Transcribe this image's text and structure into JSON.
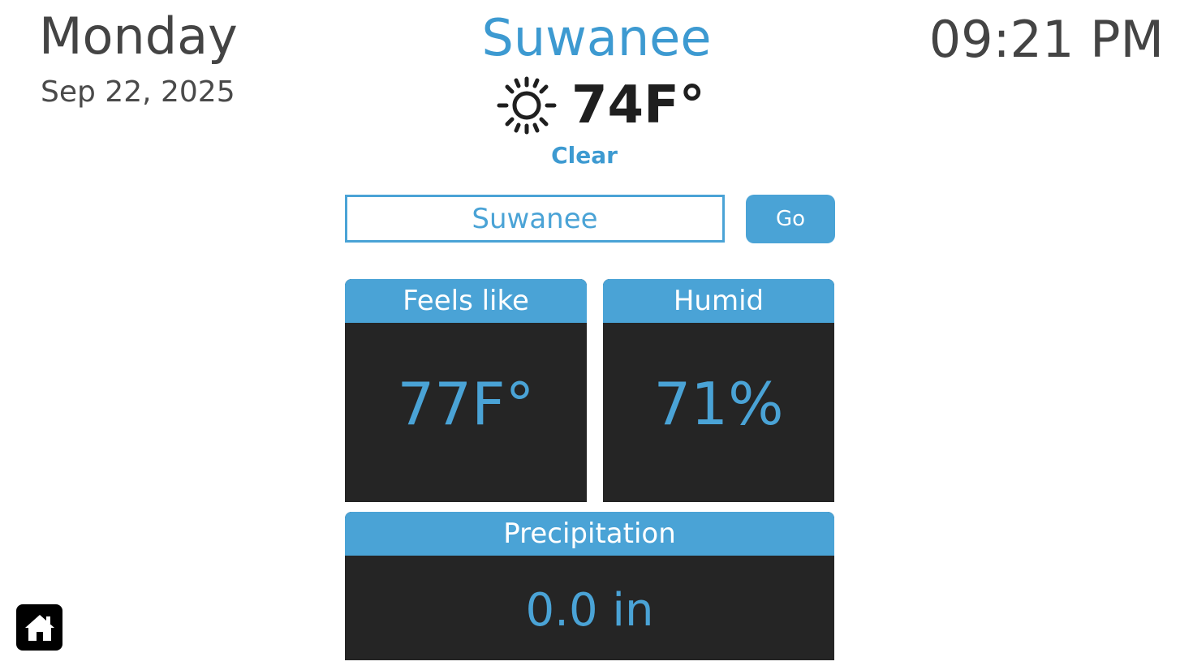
{
  "header": {
    "day": "Monday",
    "date": "Sep 22, 2025",
    "time": "09:21 PM",
    "city": "Suwanee"
  },
  "current": {
    "temperature": "74F°",
    "condition": "Clear",
    "icon": "sun-icon"
  },
  "search": {
    "value": "Suwanee",
    "button_label": "Go"
  },
  "cards": {
    "feels_like": {
      "label": "Feels like",
      "value": "77F°"
    },
    "humidity": {
      "label": "Humid",
      "value": "71%"
    },
    "precipitation": {
      "label": "Precipitation",
      "value": "0.0 in"
    }
  },
  "home": {
    "icon": "home-icon"
  },
  "colors": {
    "accent": "#4aa3d6",
    "card_background": "#252525",
    "text_dark": "#444444"
  }
}
